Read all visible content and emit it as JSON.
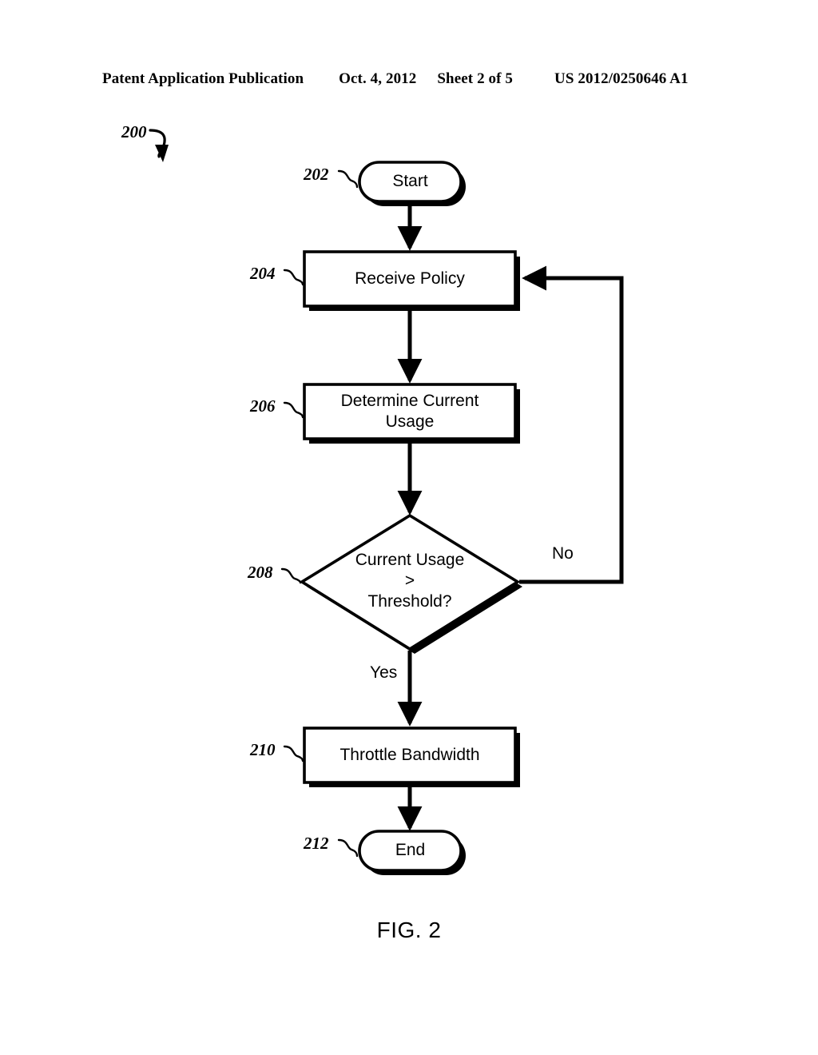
{
  "header": {
    "publication": "Patent Application Publication",
    "date": "Oct. 4, 2012",
    "sheet": "Sheet 2 of 5",
    "doc_number": "US 2012/0250646 A1"
  },
  "figure": {
    "caption": "FIG. 2",
    "diagram_ref": "200",
    "type": "flowchart",
    "nodes": [
      {
        "ref": "202",
        "shape": "terminator",
        "text": "Start"
      },
      {
        "ref": "204",
        "shape": "process",
        "text": "Receive Policy"
      },
      {
        "ref": "206",
        "shape": "process",
        "text": "Determine Current\nUsage"
      },
      {
        "ref": "208",
        "shape": "decision",
        "text": "Current Usage\n>\nThreshold?"
      },
      {
        "ref": "210",
        "shape": "process",
        "text": "Throttle Bandwidth"
      },
      {
        "ref": "212",
        "shape": "terminator",
        "text": "End"
      }
    ],
    "branch_labels": {
      "no": "No",
      "yes": "Yes"
    }
  },
  "colors": {
    "ink": "#000000",
    "paper": "#ffffff"
  }
}
